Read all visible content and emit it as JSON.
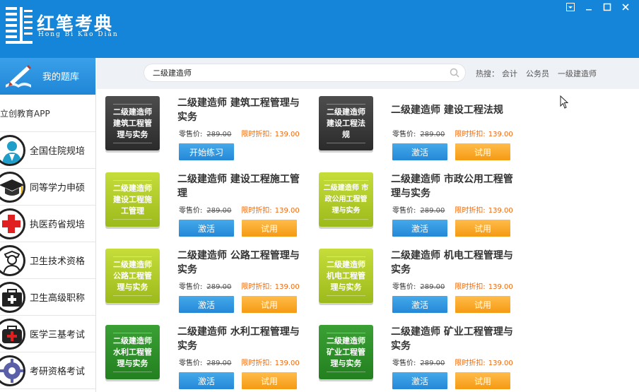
{
  "app": {
    "brand_cn": "红笔考典",
    "brand_en": "Hong Bi Kao Dian"
  },
  "sidebar": {
    "header_label": "我的题库",
    "items": [
      {
        "label": "立创教育APP",
        "icon": "app-icon"
      },
      {
        "label": "全国住院规培",
        "icon": "doctor-icon"
      },
      {
        "label": "同等学力申硕",
        "icon": "graduation-cap-icon"
      },
      {
        "label": "执医药省规培",
        "icon": "red-cross-icon"
      },
      {
        "label": "卫生技术资格",
        "icon": "nurse-icon"
      },
      {
        "label": "卫生高级职称",
        "icon": "medical-case-icon"
      },
      {
        "label": "医学三基考试",
        "icon": "medical-bag-icon"
      },
      {
        "label": "考研资格考试",
        "icon": "gear-icon"
      }
    ]
  },
  "search": {
    "value": "二级建造师",
    "hot_label": "热搜：",
    "hot_terms": [
      "会计",
      "公务员",
      "一级建造师"
    ]
  },
  "products": [
    {
      "cover": [
        "二级建造师",
        "建筑工程管",
        "理与实务"
      ],
      "cover_style": "dark",
      "title": "二级建造师 建筑工程管理与实务",
      "retail_label": "零售价:",
      "retail_price": "289.00",
      "discount_label": "限时折扣:",
      "discount_price": "139.00",
      "buttons": [
        "开始练习"
      ]
    },
    {
      "cover": [
        "二级建造师",
        "建设工程法",
        "规"
      ],
      "cover_style": "dark",
      "title": "二级建造师 建设工程法规",
      "retail_label": "零售价:",
      "retail_price": "289.00",
      "discount_label": "限时折扣:",
      "discount_price": "139.00",
      "buttons": [
        "激活",
        "试用"
      ]
    },
    {
      "cover": [
        "二级建造师",
        "建设工程施",
        "工管理"
      ],
      "cover_style": "lime",
      "title": "二级建造师 建设工程施工管理",
      "retail_label": "零售价:",
      "retail_price": "289.00",
      "discount_label": "限时折扣:",
      "discount_price": "139.00",
      "buttons": [
        "激活",
        "试用"
      ]
    },
    {
      "cover": [
        "二级建造师 市",
        "政公用工程管",
        "理与实务"
      ],
      "cover_style": "lime",
      "title": "二级建造师 市政公用工程管理与实务",
      "retail_label": "零售价:",
      "retail_price": "289.00",
      "discount_label": "限时折扣:",
      "discount_price": "139.00",
      "buttons": [
        "激活",
        "试用"
      ]
    },
    {
      "cover": [
        "二级建造师",
        "公路工程管",
        "理与实务"
      ],
      "cover_style": "lime",
      "title": "二级建造师 公路工程管理与实务",
      "retail_label": "零售价:",
      "retail_price": "289.00",
      "discount_label": "限时折扣:",
      "discount_price": "139.00",
      "buttons": [
        "激活",
        "试用"
      ]
    },
    {
      "cover": [
        "二级建造师",
        "机电工程管",
        "理与实务"
      ],
      "cover_style": "lime",
      "title": "二级建造师 机电工程管理与实务",
      "retail_label": "零售价:",
      "retail_price": "289.00",
      "discount_label": "限时折扣:",
      "discount_price": "139.00",
      "buttons": [
        "激活",
        "试用"
      ]
    },
    {
      "cover": [
        "二级建造师",
        "水利工程管",
        "理与实务"
      ],
      "cover_style": "green",
      "title": "二级建造师 水利工程管理与实务",
      "retail_label": "零售价:",
      "retail_price": "289.00",
      "discount_label": "限时折扣:",
      "discount_price": "139.00",
      "buttons": [
        "激活",
        "试用"
      ]
    },
    {
      "cover": [
        "二级建造师",
        "矿业工程管",
        "理与实务"
      ],
      "cover_style": "green",
      "title": "二级建造师 矿业工程管理与实务",
      "retail_label": "零售价:",
      "retail_price": "289.00",
      "discount_label": "限时折扣:",
      "discount_price": "139.00",
      "buttons": [
        "激活",
        "试用"
      ]
    }
  ],
  "colors": {
    "brand_blue": "#1485d8",
    "discount_orange": "#ee6a0e",
    "button_blue": "#2488d8",
    "button_orange": "#f59a12"
  }
}
